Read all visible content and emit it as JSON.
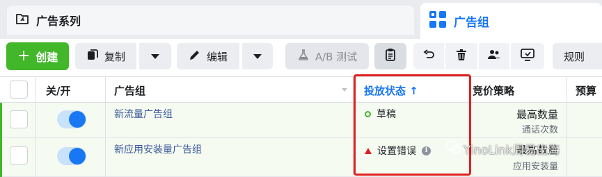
{
  "tabs": {
    "campaigns_label": "广告系列",
    "adsets_label": "广告组"
  },
  "toolbar": {
    "create_label": "创建",
    "duplicate_label": "复制",
    "edit_label": "编辑",
    "ab_test_label": "A/B 测试",
    "rules_label": "规则"
  },
  "table": {
    "columns": {
      "toggle": "关/开",
      "name": "广告组",
      "status": "投放状态",
      "sort_arrow": "↑",
      "bid": "竞价策略",
      "budget": "预算"
    },
    "rows": [
      {
        "name": "新流量广告组",
        "status": "草稿",
        "bid_main": "最高数量",
        "bid_sub": "通话次数"
      },
      {
        "name": "新应用安装量广告组",
        "status": "设置错误",
        "bid_main": "最高数量",
        "bid_sub": "应用安装量"
      }
    ]
  },
  "watermark": {
    "text": "YinoLink周易出海"
  },
  "colors": {
    "accent_green": "#42b72a",
    "brand_blue": "#1877f2",
    "highlight_red": "#e02020"
  }
}
